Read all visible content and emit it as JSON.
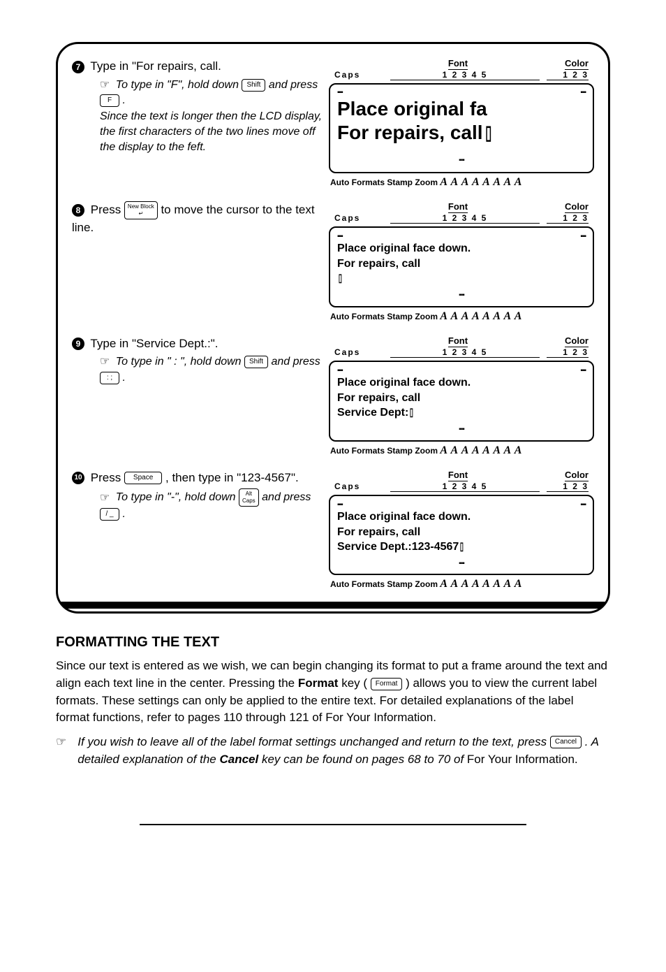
{
  "panel": {
    "step7": {
      "num": "7",
      "instruction": "Type in \"For repairs, call.",
      "note_a_pre": "To type in \"F\", hold down ",
      "note_a_key1": "Shift",
      "note_a_mid": " and press ",
      "note_a_key2": "F",
      "note_a_post": "  .",
      "note_b": "Since the text is longer then the LCD display, the first characters of the two lines move off the display to the feft.",
      "lcd": {
        "caps": "Caps",
        "font": "Font",
        "color": "Color",
        "nums_font": "1 2 3 4 5",
        "nums_color": "1 2 3",
        "line1": "Place original fa",
        "line2": "For repairs, call",
        "footer": "Auto Formats Stamp Zoom"
      }
    },
    "step8": {
      "num": "8",
      "instruction_pre": "Press ",
      "instruction_key": "New Block\n↵",
      "instruction_post": " to move the cursor to the text line.",
      "lcd": {
        "caps": "Caps",
        "font": "Font",
        "color": "Color",
        "nums_font": "1 2 3 4 5",
        "nums_color": "1 2 3",
        "line1": "Place original face down.",
        "line2": "For repairs, call",
        "footer": "Auto Formats Stamp Zoom"
      }
    },
    "step9": {
      "num": "9",
      "instruction": "Type in \"Service Dept.:\".",
      "note_pre": "To type in \" : \", hold down ",
      "note_key1": "Shift",
      "note_mid": " and press ",
      "note_key2": ": ;",
      "note_post": " .",
      "lcd": {
        "caps": "Caps",
        "font": "Font",
        "color": "Color",
        "nums_font": "1 2 3 4 5",
        "nums_color": "1 2 3",
        "line1": "Place original face down.",
        "line2": "For repairs, call",
        "line3": "Service Dept:",
        "footer": "Auto Formats Stamp Zoom"
      }
    },
    "step10": {
      "num": "10",
      "instruction_pre": "Press ",
      "instruction_key": "Space",
      "instruction_post": " , then type in \"123-4567\".",
      "note_pre": "To type in \"-\", hold down ",
      "note_key1": "Alt\nCaps",
      "note_mid": " and press ",
      "note_key2": "/  _",
      "note_post": " .",
      "lcd": {
        "caps": "Caps",
        "font": "Font",
        "color": "Color",
        "nums_font": "1 2 3 4 5",
        "nums_color": "1 2 3",
        "line1": "Place original face down.",
        "line2": "For repairs, call",
        "line3": "Service Dept.:123-4567",
        "footer": "Auto Formats Stamp Zoom"
      }
    }
  },
  "section": {
    "heading": "FORMATTING THE TEXT",
    "body_pre": "Since our text is entered as we wish, we can begin changing its format to put a frame around the text and align each text line in the center.  Pressing the ",
    "body_format": "Format",
    "body_mid": " key ( ",
    "body_key": "Format",
    "body_post": " ) allows you to view the current label formats.  These settings can only be applied to the entire text.  For detailed explanations of the label format functions, refer to pages 110 through 121 of For Your Information.",
    "foot_pre": "If you wish to leave all of the label format settings unchanged and return to the text, press ",
    "foot_key": "Cancel",
    "foot_mid": " .  A detailed explanation of the ",
    "foot_cancel": "Cancel",
    "foot_post": " key can be found on pages 68 to 70 of ",
    "foot_tail": "For Your Information."
  },
  "aa_styles": "A A A A A A A A"
}
